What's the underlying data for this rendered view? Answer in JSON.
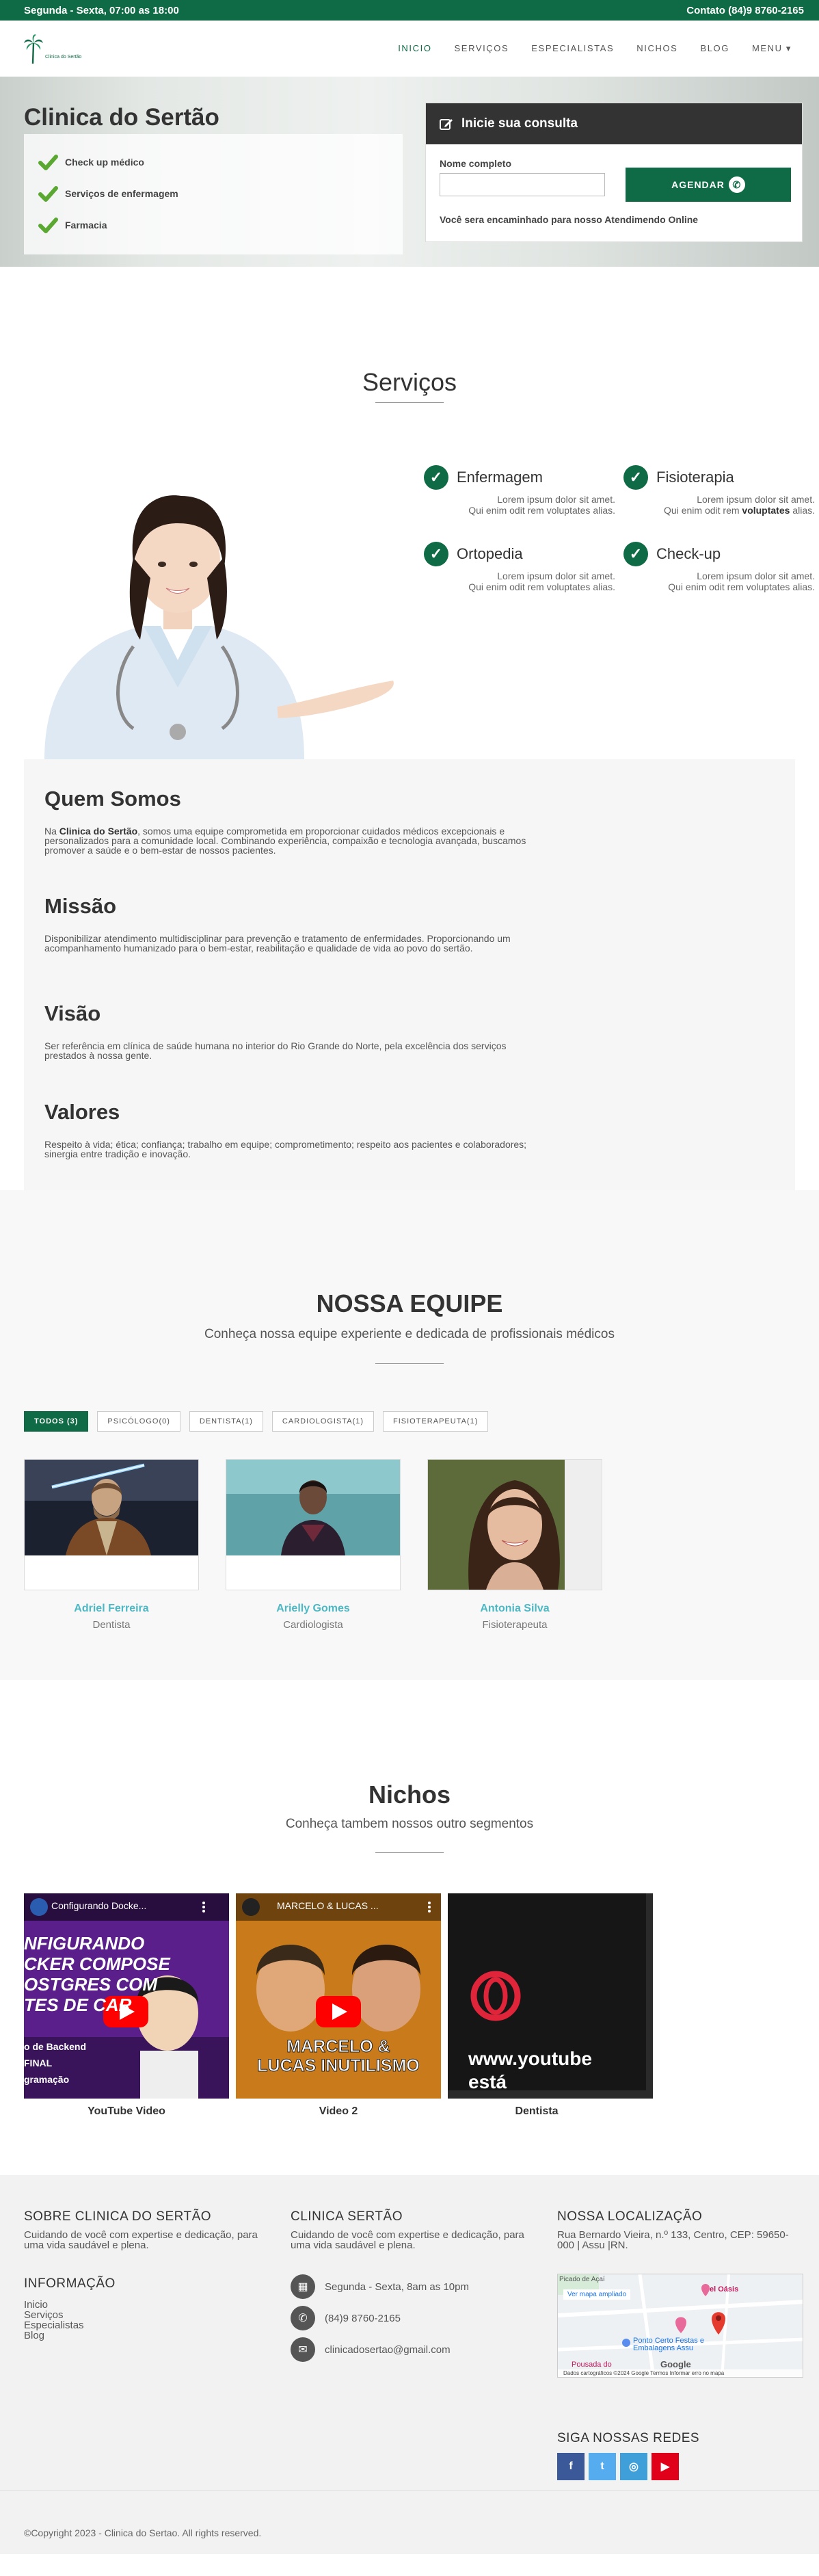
{
  "topbar": {
    "hours": "Segunda - Sexta, 07:00 as 18:00",
    "contact": "Contato (84)9 8760-2165"
  },
  "logo": {
    "text": "Clinica do Sertão"
  },
  "nav": {
    "items": [
      {
        "label": "INICIO",
        "active": true
      },
      {
        "label": "SERVIÇOS",
        "active": false
      },
      {
        "label": "ESPECIALISTAS",
        "active": false
      },
      {
        "label": "NICHOS",
        "active": false
      },
      {
        "label": "BLOG",
        "active": false
      },
      {
        "label": "MENU ▾",
        "active": false
      }
    ]
  },
  "hero": {
    "title": "Clinica do Sertão",
    "list": [
      "Check up médico",
      "Serviços de enfermagem",
      "Farmacia"
    ],
    "form": {
      "title": "Inicie sua consulta",
      "name_label": "Nome completo",
      "name_value": "",
      "button": "AGENDAR",
      "note": "Você sera encaminhado para nosso Atendimendo Online"
    }
  },
  "servicos": {
    "title": "Serviços",
    "items": [
      {
        "name": "Enfermagem",
        "line1": "Lorem ipsum dolor sit amet.",
        "line2_pre": "Qui enim odit rem voluptates alias.",
        "line2_bold": ""
      },
      {
        "name": "Fisioterapia",
        "line1": "Lorem ipsum dolor sit amet.",
        "line2_pre": "Qui enim odit rem ",
        "line2_bold": "voluptates",
        "line2_post": " alias."
      },
      {
        "name": "Ortopedia",
        "line1": "Lorem ipsum dolor sit amet.",
        "line2_pre": "Qui enim odit rem voluptates alias.",
        "line2_bold": ""
      },
      {
        "name": "Check-up",
        "line1": "Lorem ipsum dolor sit amet.",
        "line2_pre": "Qui enim odit rem voluptates alias.",
        "line2_bold": ""
      }
    ]
  },
  "about": {
    "quem": {
      "title": "Quem Somos",
      "pre": "Na ",
      "bold": "Clinica do Sertão",
      "post": ", somos uma equipe comprometida em proporcionar cuidados médicos excepcionais e personalizados para a comunidade local. Combinando experiência, compaixão e tecnologia avançada, buscamos promover a saúde e o bem-estar de nossos pacientes."
    },
    "missao": {
      "title": "Missão",
      "text": "Disponibilizar atendimento multidisciplinar para prevenção e tratamento de enfermidades. Proporcionando um acompanhamento humanizado para o bem-estar, reabilitação e qualidade de vida ao povo do sertão."
    },
    "visao": {
      "title": "Visão",
      "text": "Ser referência em clínica de saúde humana no interior do Rio Grande do Norte, pela excelência dos serviços prestados à nossa gente."
    },
    "valores": {
      "title": "Valores",
      "text": "Respeito à vida; ética; confiança; trabalho em equipe; comprometimento; respeito aos pacientes e colaboradores; sinergia entre tradição e inovação."
    }
  },
  "equipe": {
    "title": "NOSSA EQUIPE",
    "subtitle": "Conheça nossa equipe experiente e dedicada de profissionais médicos",
    "filters": [
      "TODOS (3)",
      "PSICÓLOGO(0)",
      "DENTISTA(1)",
      "CARDIOLOGISTA(1)",
      "FISIOTERAPEUTA(1)"
    ],
    "members": [
      {
        "name": "Adriel Ferreira",
        "role": "Dentista"
      },
      {
        "name": "Arielly Gomes",
        "role": "Cardiologista"
      },
      {
        "name": "Antonia Silva",
        "role": "Fisioterapeuta"
      }
    ]
  },
  "nichos": {
    "title": "Nichos",
    "subtitle": "Conheça tambem nossos outro segmentos",
    "videos": [
      {
        "caption": "YouTube Video",
        "header": "Configurando Docke...",
        "overlay": "NFIGURANDO\nCKER COMPOSE\nOSTGRES COM\nTES DE CAR",
        "bottom": "o de Backend\nFINAL\ngramação"
      },
      {
        "caption": "Video 2",
        "header": "MARCELO & LUCAS ...",
        "overlay": "MARCELO &\nLUCAS INUTILISMO"
      },
      {
        "caption": "Dentista",
        "overlay": "www.youtube\nestá"
      }
    ]
  },
  "footer": {
    "about": {
      "title": "SOBRE CLINICA DO SERTÃO",
      "text": "Cuidando de você com expertise e dedicação, para uma vida saudável e plena."
    },
    "info": {
      "title": "INFORMAÇÃO",
      "links": [
        "Inicio",
        "Serviços",
        "Especialistas",
        "Blog"
      ]
    },
    "clinica": {
      "title": "CLINICA SERTÃO",
      "text": "Cuidando de você com expertise e dedicação, para uma vida saudável e plena.",
      "hours": "Segunda - Sexta, 8am as 10pm",
      "phone": "(84)9 8760-2165",
      "email": "clinicadosertao@gmail.com"
    },
    "local": {
      "title": "NOSSA LOCALIZAÇÃO",
      "text": "Rua Bernardo Vieira, n.º 133, Centro, CEP: 59650-000 | Assu |RN."
    },
    "map": {
      "link": "Ver mapa ampliado",
      "place1": "Picado de Açaí",
      "place2": "el Oásis",
      "place3": "Ponto Certo Festas e Embalagens Assu",
      "place4": "Pousada do",
      "brand": "Google",
      "attrib": "Dados cartográficos ©2024 Google   Termos   Informar erro no mapa"
    },
    "social_title": "SIGA NOSSAS REDES",
    "social": [
      "f",
      "t",
      "◎",
      "▶"
    ],
    "copyright": "©Copyright 2023 - Clinica do Sertao. All rights reserved."
  },
  "colors": {
    "brand_green": "#0f6b45",
    "member_name": "#4cb8c4",
    "facebook": "#3b5998",
    "twitter": "#55acee",
    "instagram": "#3f9fd8",
    "youtube": "#e0001a"
  }
}
